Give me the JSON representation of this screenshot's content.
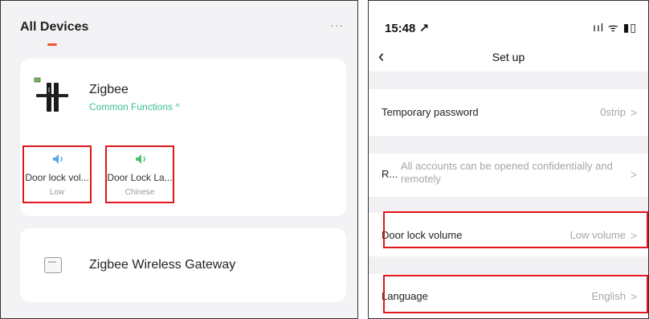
{
  "left": {
    "header": {
      "title": "All Devices",
      "more": "···"
    },
    "devices": [
      {
        "name": "Zigbee",
        "functions_label": "Common Functions ^",
        "tiles": [
          {
            "label": "Door lock vol...",
            "value": "Low"
          },
          {
            "label": "Door Lock La...",
            "value": "Chinese"
          }
        ]
      },
      {
        "name": "Zigbee Wireless Gateway"
      }
    ]
  },
  "right": {
    "status": {
      "time": "15:48 ↗",
      "icons": "ııl ᯤ ▮▯"
    },
    "nav": {
      "back": "‹",
      "title": "Set up"
    },
    "rows": [
      {
        "label": "Temporary password",
        "value": "0strip"
      },
      {
        "label": "R...",
        "value": "All accounts can be opened confidentially and remotely"
      },
      {
        "label": "Door lock volume",
        "value": "Low volume"
      },
      {
        "label": "Language",
        "value": "English"
      }
    ],
    "chevron": ">"
  },
  "colors": {
    "accent_orange": "#f0542f",
    "function_green": "#3bbf8e",
    "highlight_red": "#e0161c",
    "volume_blue": "#56a8e8",
    "volume_green": "#4cc36b"
  },
  "icons": {
    "lock": "door-lock-icon",
    "volume_low": "speaker-icon",
    "language": "speaker-icon",
    "gateway": "gateway-icon",
    "back": "chevron-left-icon",
    "row_arrow": "chevron-right-icon"
  }
}
